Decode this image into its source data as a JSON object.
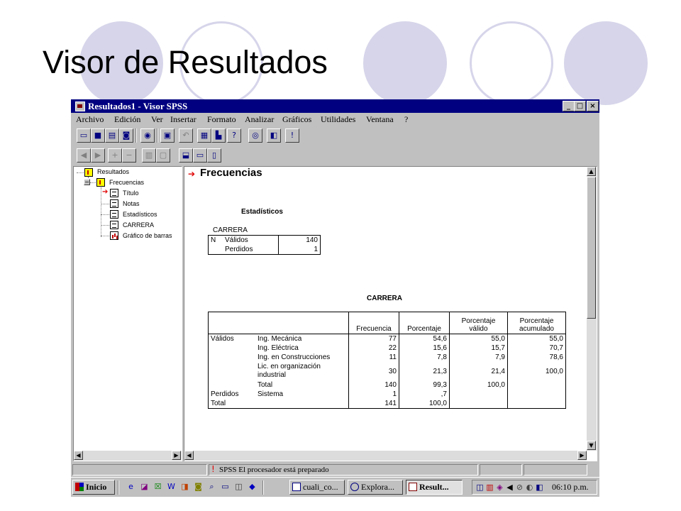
{
  "slide": {
    "title": "Visor de Resultados"
  },
  "window": {
    "title": "Resultados1 - Visor SPSS",
    "minimize": "_",
    "maximize": "□",
    "close": "×"
  },
  "menu": [
    "Archivo",
    "Edición",
    "Ver",
    "Insertar",
    "Formato",
    "Analizar",
    "Gráficos",
    "Utilidades",
    "Ventana",
    "?"
  ],
  "toolbar1": [
    "open-icon",
    "save-icon",
    "print-icon",
    "print-preview-icon",
    "export-icon",
    "dialog-recall-icon",
    "undo-icon",
    "goto-data-icon",
    "goto-chart-icon",
    "variables-icon",
    "use-sets-icon",
    "designate-window-icon",
    "run-icon"
  ],
  "toolbar2": [
    "promote-icon",
    "demote-icon",
    "expand-icon",
    "collapse-icon",
    "show-icon",
    "hide-icon",
    "insert-heading-icon",
    "insert-title-icon",
    "insert-text-icon"
  ],
  "tree": {
    "root": "Resultados",
    "child": "Frecuencias",
    "items": [
      "Título",
      "Notas",
      "Estadísticos",
      "CARRERA",
      "Gráfico de barras"
    ]
  },
  "output": {
    "heading": "Frecuencias",
    "stats_title": "Estadísticos",
    "stats_var": "CARRERA",
    "stats": {
      "n_label": "N",
      "rows": [
        {
          "label": "Válidos",
          "value": "140"
        },
        {
          "label": "Perdidos",
          "value": "1"
        }
      ]
    },
    "freq_title": "CARRERA",
    "freq_headers": [
      "Frecuencia",
      "Porcentaje",
      "Porcentaje válido",
      "Porcentaje acumulado"
    ],
    "freq_rows": [
      {
        "group": "Válidos",
        "label": "Ing. Mecánica",
        "f": "77",
        "p": "54,6",
        "pv": "55,0",
        "pa": "55,0"
      },
      {
        "group": "",
        "label": "Ing. Eléctrica",
        "f": "22",
        "p": "15,6",
        "pv": "15,7",
        "pa": "70,7"
      },
      {
        "group": "",
        "label": "Ing. en Construcciones",
        "f": "11",
        "p": "7,8",
        "pv": "7,9",
        "pa": "78,6"
      },
      {
        "group": "",
        "label": "Lic. en organización industrial",
        "f": "30",
        "p": "21,3",
        "pv": "21,4",
        "pa": "100,0"
      },
      {
        "group": "",
        "label": "Total",
        "f": "140",
        "p": "99,3",
        "pv": "100,0",
        "pa": ""
      },
      {
        "group": "Perdidos",
        "label": "Sistema",
        "f": "1",
        "p": ",7",
        "pv": "",
        "pa": ""
      },
      {
        "group": "Total",
        "label": "",
        "f": "141",
        "p": "100,0",
        "pv": "",
        "pa": ""
      }
    ]
  },
  "status": {
    "text": "SPSS El procesador está preparado"
  },
  "taskbar": {
    "start": "Inicio",
    "tasks": [
      "cuali_co...",
      "Explora...",
      "Result..."
    ],
    "clock": "06:10 p.m."
  },
  "colors": {
    "titlebar": "#000080",
    "face": "#c0c0c0",
    "decor": "#d6d5ea",
    "accent_red": "#e00000"
  }
}
